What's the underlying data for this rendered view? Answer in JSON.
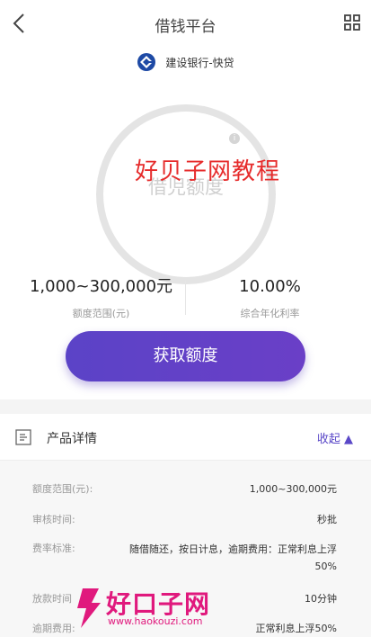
{
  "nav": {
    "title": "借钱平台"
  },
  "bank": {
    "name": "建设银行-快贷"
  },
  "ring": {
    "text": "借児额度"
  },
  "watermark_text": "好贝子网教程",
  "stats": {
    "range_value": "1,000~300,000元",
    "range_label": "额度范围(元)",
    "rate_value": "10.00%",
    "rate_label": "综合年化利率"
  },
  "cta_label": "获取额度",
  "section": {
    "title": "产品详情",
    "collapse_label": "收起 ▲"
  },
  "details": [
    {
      "label": "额度范围(元):",
      "value": "1,000~300,000元"
    },
    {
      "label": "审核时间:",
      "value": "秒批"
    },
    {
      "label": "费率标准:",
      "value": "随借随还，按日计息，逾期费用：正常利息上浮50%"
    },
    {
      "label": "放款时间",
      "value": "10分钟"
    },
    {
      "label": "逾期费用:",
      "value": "正常利息上浮50%"
    }
  ],
  "logo": {
    "text": "好口子网",
    "url": "www.haokouzi.com"
  },
  "colors": {
    "accent": "#5a48c8",
    "watermark": "#e62c2c",
    "logo": "#e0197d"
  }
}
